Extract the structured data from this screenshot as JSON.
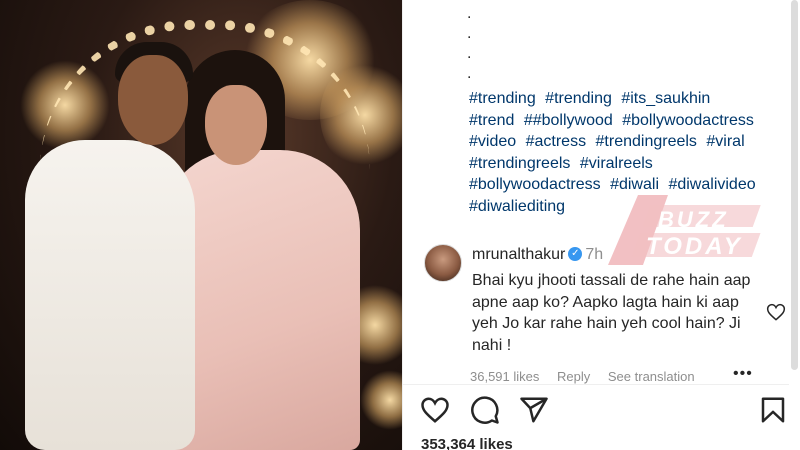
{
  "dots": [
    ".",
    ".",
    ".",
    "."
  ],
  "caption": {
    "hashtags": [
      "#trending",
      "#trending",
      "#its_saukhin",
      "#trend",
      "##bollywood",
      "#bollywoodactress",
      "#video",
      "#actress",
      "#trendingreels",
      "#viral",
      "#trendingreels",
      "#viralreels",
      "#bollywoodactress",
      "#diwali",
      "#diwalivideo",
      "#diwaliediting"
    ]
  },
  "watermark": {
    "line1": "BUZZ",
    "line2": "TODAY"
  },
  "comment": {
    "username": "mrunalthakur",
    "verified_icon": "verified-badge-icon",
    "time": "7h",
    "text": "Bhai kyu jhooti tassali de rahe hain aap apne aap ko? Aapko lagta hain ki aap yeh Jo kar rahe hain yeh cool hain? Ji nahi !",
    "likes": "36,591 likes",
    "reply_label": "Reply",
    "translation_label": "See translation",
    "more_label": "•••"
  },
  "actions": {
    "like_icon": "heart-icon",
    "comment_icon": "comment-icon",
    "share_icon": "share-icon",
    "save_icon": "bookmark-icon"
  },
  "post": {
    "likes": "353,364 likes"
  },
  "colors": {
    "hashtag": "#00376b",
    "verified": "#3797f0",
    "watermark": "#d21f2a"
  }
}
